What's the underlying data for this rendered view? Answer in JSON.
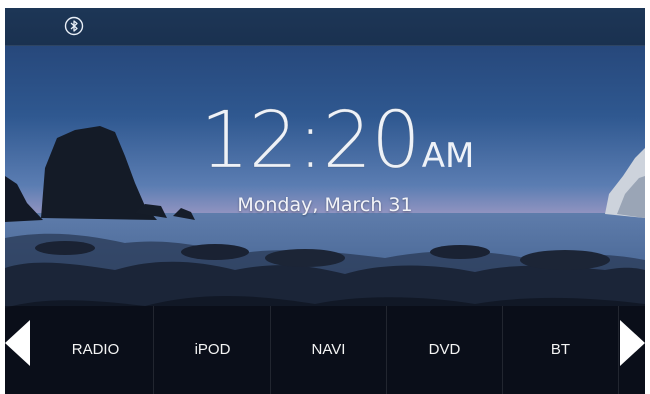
{
  "status_bar": {
    "bluetooth_icon": "bluetooth-icon"
  },
  "clock": {
    "time": "12:20",
    "ampm": "AM"
  },
  "date": "Monday, March 31",
  "menu": [
    {
      "label": "RADIO"
    },
    {
      "label": "iPOD"
    },
    {
      "label": "NAVI"
    },
    {
      "label": "DVD"
    },
    {
      "label": "BT"
    }
  ],
  "navigation": {
    "prev_icon": "arrow-left-icon",
    "next_icon": "arrow-right-icon"
  },
  "colors": {
    "status_bar": "#1c3454",
    "sky_top": "#2b4f8a",
    "sky_horizon": "#c7a6c4",
    "menu_bar": "#06080e"
  }
}
